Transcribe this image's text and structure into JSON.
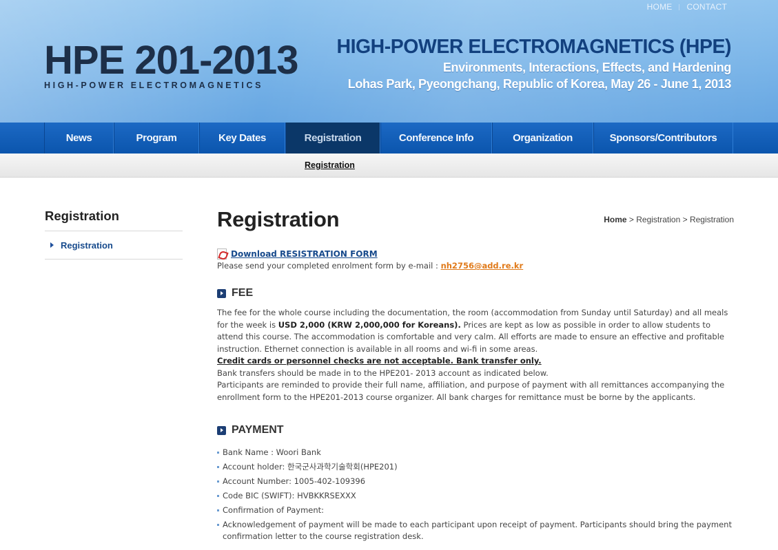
{
  "top_links": {
    "home": "HOME",
    "contact": "CONTACT"
  },
  "logo": {
    "main": "HPE 201-2013",
    "sub": "HIGH-POWER ELECTROMAGNETICS"
  },
  "conference": {
    "title": "HIGH-POWER ELECTROMAGNETICS (HPE)",
    "subtitle": "Environments, Interactions, Effects, and Hardening",
    "location": "Lohas Park, Pyeongchang, Republic of Korea,  May 26 - June 1, 2013"
  },
  "nav": {
    "items": [
      {
        "label": "News"
      },
      {
        "label": "Program"
      },
      {
        "label": "Key Dates"
      },
      {
        "label": "Registration",
        "active": true
      },
      {
        "label": "Conference Info"
      },
      {
        "label": "Organization"
      },
      {
        "label": "Sponsors/Contributors"
      }
    ]
  },
  "subnav": {
    "active_label": "Registration"
  },
  "sidebar": {
    "title": "Registration",
    "items": [
      {
        "label": "Registration"
      }
    ]
  },
  "main": {
    "title": "Registration",
    "breadcrumb": {
      "home": "Home",
      "sep1": " > ",
      "level1": "Registration",
      "sep2": " > ",
      "level2": "Registration"
    },
    "download": {
      "label": "Download RESISTRATION FORM",
      "icon": "pdf-icon"
    },
    "send_line": {
      "text": "Please send your completed enrolment form by e-mail : ",
      "email": "nh2756@add.re.kr"
    },
    "fee": {
      "heading": "FEE",
      "p1_a": "The fee for the whole course including the documentation, the room (accommodation from Sunday until Saturday) and all meals for the week is ",
      "p1_bold": "USD 2,000 (KRW 2,000,000 for Koreans).",
      "p1_b": " Prices are kept as low as possible in order to allow students to attend this course. The accommodation is comfortable and very calm. All efforts are made to ensure an effective and profitable instruction. Ethernet connection is available in all rooms and wi-fi in some areas.",
      "warning": "Credit cards or personnel checks are not acceptable. Bank transfer only.",
      "p2": "Bank transfers should be made in to the HPE201- 2013 account as indicated below.",
      "p3": "Participants are reminded to provide their full name, affiliation, and purpose of payment with all remittances accompanying the enrollment form to the HPE201-2013 course organizer. All bank charges for remittance must be borne by the applicants."
    },
    "payment": {
      "heading": "PAYMENT",
      "items": [
        "Bank Name : Woori Bank",
        "Account holder: 한국군사과학기술학회(HPE201)",
        "Account Number: 1005-402-109396",
        "Code BIC (SWIFT): HVBKKRSEXXX",
        "Confirmation of Payment:",
        "Acknowledgement of payment will be made to each participant upon receipt of payment. Participants should bring the payment confirmation letter to the course registration desk."
      ]
    }
  },
  "colors": {
    "nav_bg": "#0b55ad",
    "nav_active": "#0b3768",
    "link_blue": "#174a8c",
    "email_orange": "#e07a1a",
    "header_blue": "#79b4e8"
  }
}
